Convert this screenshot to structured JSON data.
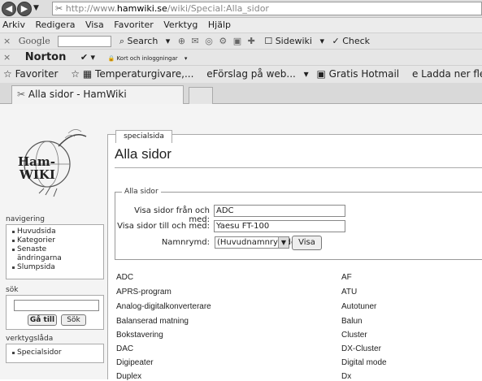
{
  "browser": {
    "address_prefix": "http://www.",
    "address_domain": "hamwiki.se",
    "address_path": "/wiki/Special:Alla_sidor",
    "menu": [
      "Arkiv",
      "Redigera",
      "Visa",
      "Favoriter",
      "Verktyg",
      "Hjälp"
    ],
    "toolbar1": {
      "google": "Google",
      "search": "Search",
      "sidewiki": "Sidewiki",
      "check": "Check"
    },
    "toolbar2": {
      "norton": "Norton",
      "passwords": "Kort och inloggningar"
    },
    "favorites": {
      "label": "Favoriter",
      "items": [
        "Temperaturgivare,...",
        "Förslag på web...",
        "Gratis Hotmail",
        "Ladda ner fle..."
      ]
    },
    "tab_title": "Alla sidor - HamWiki"
  },
  "sidebar": {
    "logo_text": [
      "Ham-",
      "WIKI"
    ],
    "nav_heading": "navigering",
    "nav_items": [
      "Huvudsida",
      "Kategorier",
      "Senaste ändringarna",
      "Slumpsida"
    ],
    "search_heading": "sök",
    "go_button": "Gå till",
    "search_button": "Sök",
    "tools_heading": "verktygslåda",
    "tools_items": [
      "Specialsidor"
    ]
  },
  "content": {
    "tab_label": "specialsida",
    "title": "Alla sidor",
    "legend": "Alla sidor",
    "from_label": "Visa sidor från och med:",
    "from_value": "ADC",
    "to_label": "Visa sidor till och med:",
    "to_value": "Yaesu FT-100",
    "namespace_label": "Namnrymd:",
    "namespace_value": "(Huvudnamnrymden)",
    "show_button": "Visa",
    "col1": [
      "ADC",
      "APRS-program",
      "Analog-digitalkonverterare",
      "Balanserad matning",
      "Bokstavering",
      "DAC",
      "Digipeater",
      "Duplex"
    ],
    "col2": [
      "AF",
      "ATU",
      "Autotuner",
      "Balun",
      "Cluster",
      "DX-Cluster",
      "Digital mode",
      "Dx"
    ]
  }
}
